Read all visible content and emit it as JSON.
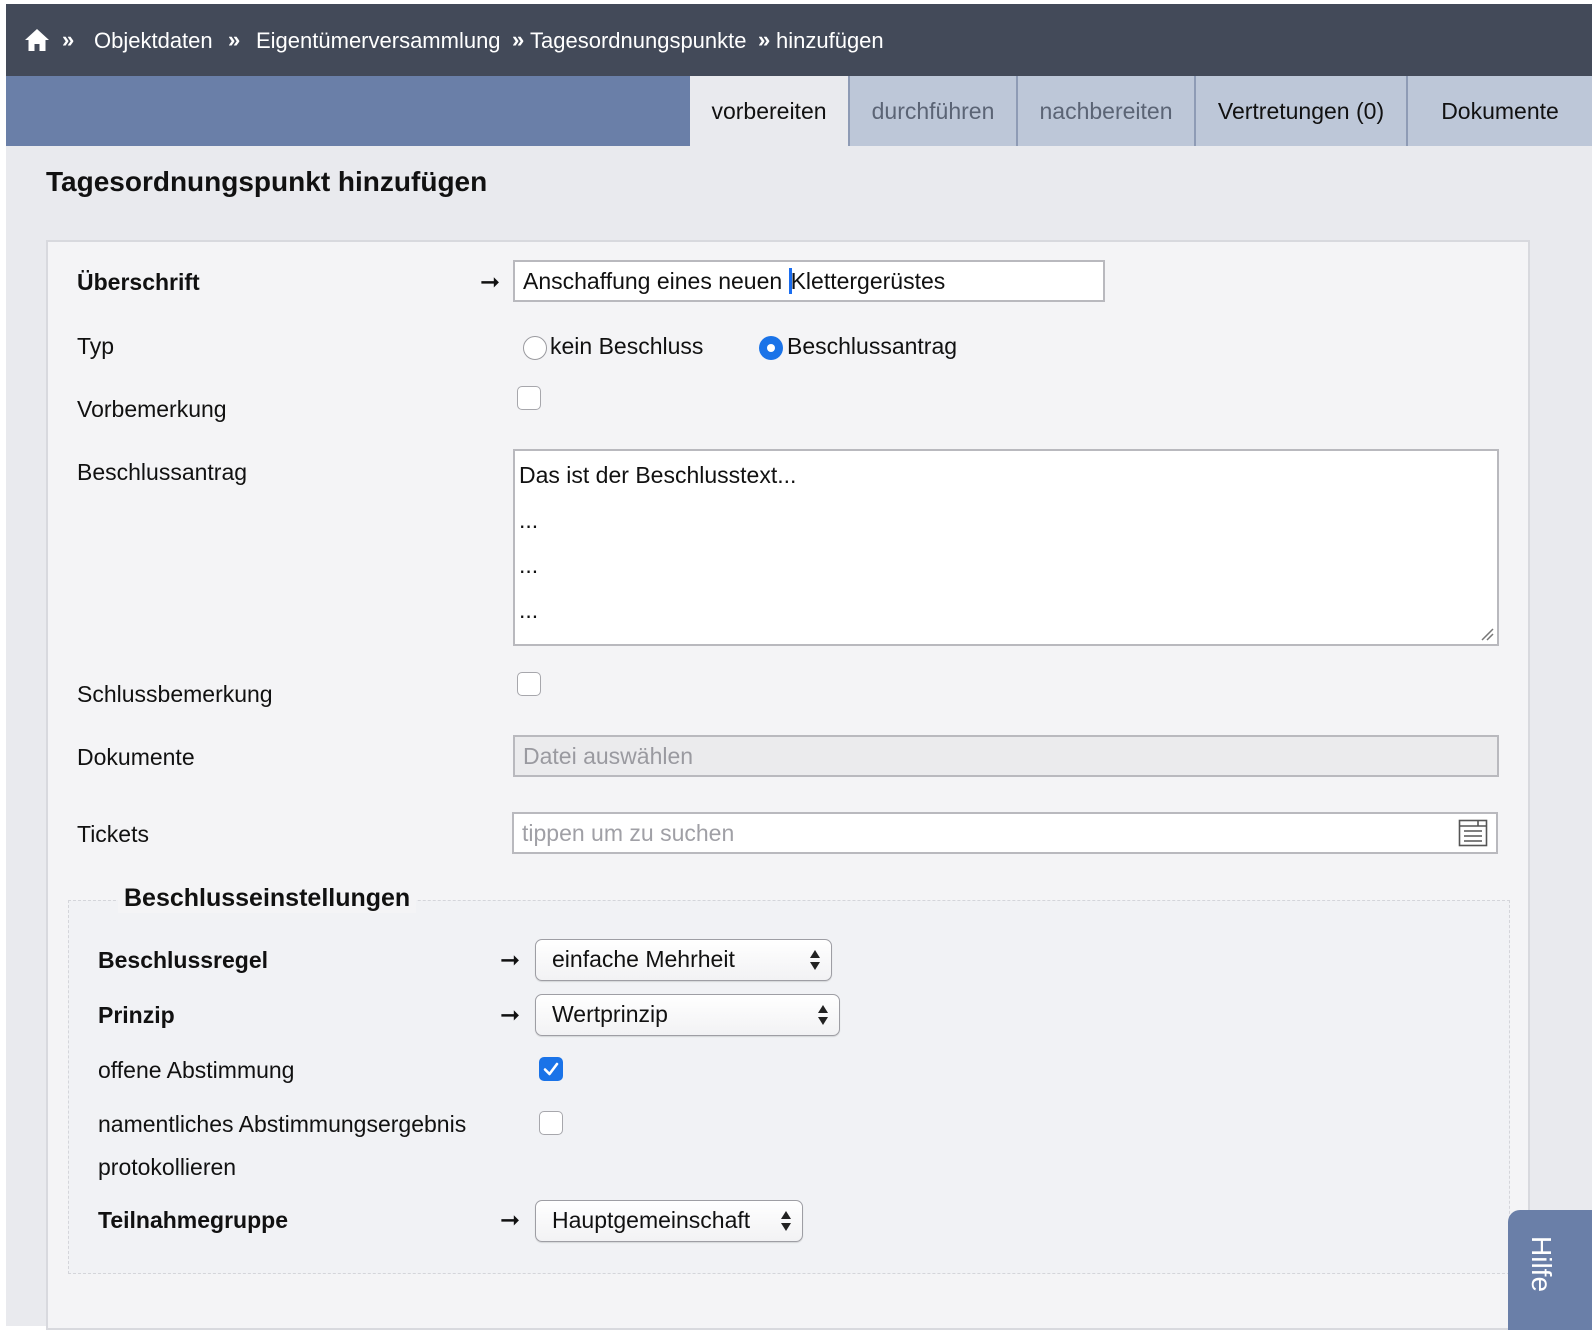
{
  "breadcrumb": {
    "separator": "»",
    "items": [
      "Objektdaten",
      "Eigentümerversammlung",
      "Tagesordnungspunkte",
      "hinzufügen"
    ]
  },
  "tabs": [
    {
      "label": "vorbereiten",
      "state": "active"
    },
    {
      "label": "durchführen",
      "state": "inactive"
    },
    {
      "label": "nachbereiten",
      "state": "inactive"
    },
    {
      "label": "Vertretungen (0)",
      "state": "inactive"
    },
    {
      "label": "Dokumente",
      "state": "inactive"
    }
  ],
  "page_title": "Tagesordnungspunkt hinzufügen",
  "form": {
    "ueberschrift": {
      "label": "Überschrift",
      "value_before_caret": "Anschaffung eines neuen ",
      "value_after_caret": "Klettergerüstes"
    },
    "typ": {
      "label": "Typ",
      "options": [
        {
          "label": "kein Beschluss",
          "selected": false
        },
        {
          "label": "Beschlussantrag",
          "selected": true
        }
      ]
    },
    "vorbemerkung": {
      "label": "Vorbemerkung",
      "checked": false
    },
    "beschlussantrag": {
      "label": "Beschlussantrag",
      "lines": [
        "Das ist der Beschlusstext...",
        "...",
        "...",
        "..."
      ]
    },
    "schlussbemerkung": {
      "label": "Schlussbemerkung",
      "checked": false
    },
    "dokumente": {
      "label": "Dokumente",
      "placeholder": "Datei auswählen"
    },
    "tickets": {
      "label": "Tickets",
      "placeholder": "tippen um zu suchen"
    }
  },
  "settings": {
    "legend": "Beschlusseinstellungen",
    "beschlussregel": {
      "label": "Beschlussregel",
      "value": "einfache Mehrheit"
    },
    "prinzip": {
      "label": "Prinzip",
      "value": "Wertprinzip"
    },
    "offene_abstimmung": {
      "label": "offene Abstimmung",
      "checked": true
    },
    "namentlich": {
      "label_line1": "namentliches Abstimmungsergebnis",
      "label_line2": "protokollieren",
      "checked": false
    },
    "teilnahmegruppe": {
      "label": "Teilnahmegruppe",
      "value": "Hauptgemeinschaft"
    }
  },
  "help": {
    "label": "Hilfe"
  },
  "required_marker": "➞",
  "colors": {
    "topbar": "#434a59",
    "tabbar": "#6a7fa8",
    "tab_inactive": "#bdc7d8",
    "accent": "#1a73e8",
    "page_bg": "#e9eaee"
  }
}
